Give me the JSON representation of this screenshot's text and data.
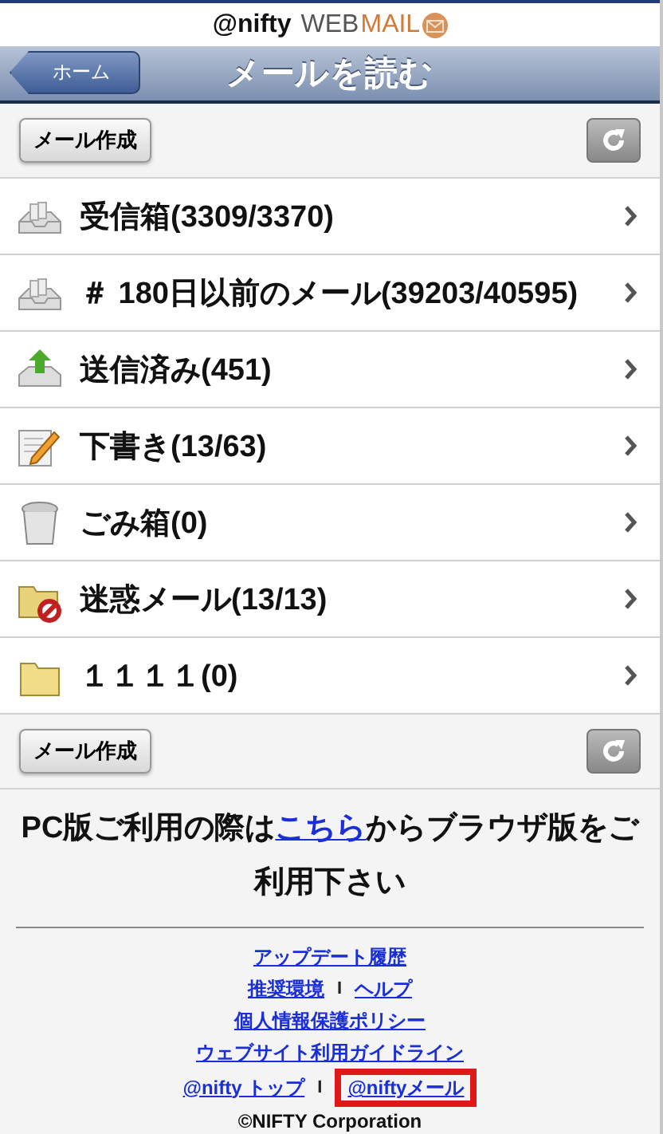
{
  "logo": {
    "brand": "@nifty",
    "web": "WEB",
    "mail": "MAIL"
  },
  "nav_bar": {
    "back_button": "ホーム",
    "title": "メールを読む"
  },
  "top_toolbar": {
    "compose_button": "メール作成"
  },
  "folders": [
    {
      "kind": "inbox",
      "label": "受信箱(3309/3370)"
    },
    {
      "kind": "inbox",
      "label": "＃ 180日以前のメール(39203/40595)"
    },
    {
      "kind": "sent",
      "label": "送信済み(451)"
    },
    {
      "kind": "draft",
      "label": "下書き(13/63)"
    },
    {
      "kind": "trash",
      "label": "ごみ箱(0)"
    },
    {
      "kind": "spam",
      "label": "迷惑メール(13/13)"
    },
    {
      "kind": "folder",
      "label": "１１１１(0)"
    }
  ],
  "bottom_toolbar": {
    "compose_button": "メール作成"
  },
  "notice": {
    "before": "PC版ご利用の際は",
    "link": "こちら",
    "after": "からブラウザ版をご利用下さい"
  },
  "footer_rows": [
    [
      {
        "kind": "link",
        "label": "アップデート履歴",
        "highlighted": false
      }
    ],
    [
      {
        "kind": "link",
        "label": "推奨環境",
        "highlighted": false
      },
      {
        "kind": "separator",
        "label": "I"
      },
      {
        "kind": "link",
        "label": "ヘルプ",
        "highlighted": false
      }
    ],
    [
      {
        "kind": "link",
        "label": "個人情報保護ポリシー",
        "highlighted": false
      }
    ],
    [
      {
        "kind": "link",
        "label": "ウェブサイト利用ガイドライン",
        "highlighted": false
      }
    ],
    [
      {
        "kind": "link",
        "label": "@nifty トップ",
        "highlighted": false
      },
      {
        "kind": "separator",
        "label": "I"
      },
      {
        "kind": "link",
        "label": "@niftyメール",
        "highlighted": true
      }
    ]
  ],
  "copyright": "©NIFTY Corporation"
}
